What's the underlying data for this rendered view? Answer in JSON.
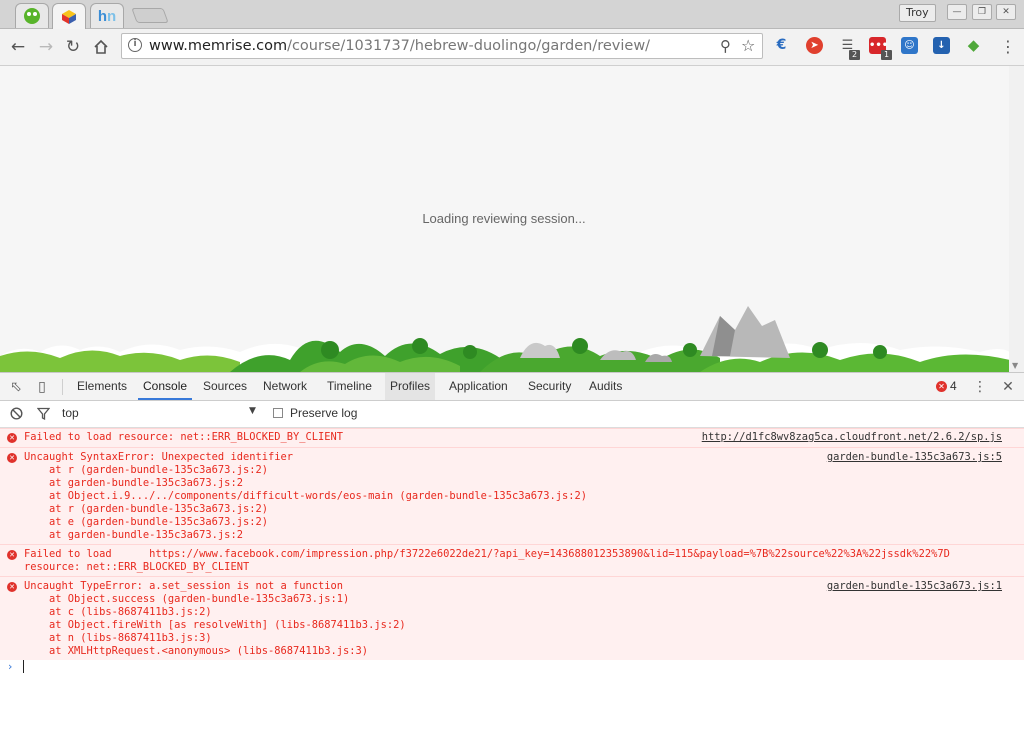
{
  "browser": {
    "profile_name": "Troy",
    "url_host": "www.memrise.com",
    "url_path": "/course/1031737/hebrew-duolingo/garden/review/",
    "extension_badges": [
      "2",
      "1"
    ]
  },
  "page": {
    "loading_text": "Loading reviewing session..."
  },
  "devtools": {
    "tabs": [
      "Elements",
      "Console",
      "Sources",
      "Network",
      "Timeline",
      "Profiles",
      "Application",
      "Security",
      "Audits"
    ],
    "active_tab": "Console",
    "error_count": "4",
    "context": "top",
    "preserve_log_label": "Preserve log"
  },
  "console": {
    "messages": [
      {
        "lines": [
          "Failed to load resource: net::ERR_BLOCKED_BY_CLIENT"
        ],
        "source": "http://d1fc8wv8zag5ca.cloudfront.net/2.6.2/sp.js"
      },
      {
        "lines": [
          "Uncaught SyntaxError: Unexpected identifier",
          "    at r (garden-bundle-135c3a673.js:2)",
          "    at garden-bundle-135c3a673.js:2",
          "    at Object.i.9.../../components/difficult-words/eos-main (garden-bundle-135c3a673.js:2)",
          "    at r (garden-bundle-135c3a673.js:2)",
          "    at e (garden-bundle-135c3a673.js:2)",
          "    at garden-bundle-135c3a673.js:2"
        ],
        "source": "garden-bundle-135c3a673.js:5"
      },
      {
        "lines": [
          "Failed to load      https://www.facebook.com/impression.php/f3722e6022de21/?api_key=143688012353890&lid=115&payload=%7B%22source%22%3A%22jssdk%22%7D",
          "resource: net::ERR_BLOCKED_BY_CLIENT"
        ],
        "source": ""
      },
      {
        "lines": [
          "Uncaught TypeError: a.set_session is not a function",
          "    at Object.success (garden-bundle-135c3a673.js:1)",
          "    at c (libs-8687411b3.js:2)",
          "    at Object.fireWith [as resolveWith] (libs-8687411b3.js:2)",
          "    at n (libs-8687411b3.js:3)",
          "    at XMLHttpRequest.<anonymous> (libs-8687411b3.js:3)"
        ],
        "source": "garden-bundle-135c3a673.js:1"
      }
    ]
  },
  "colors": {
    "error_red": "#e8291e",
    "error_bg": "#fff0f0",
    "active_tab_blue": "#3879d9",
    "memrise_green": "#4caf28"
  }
}
